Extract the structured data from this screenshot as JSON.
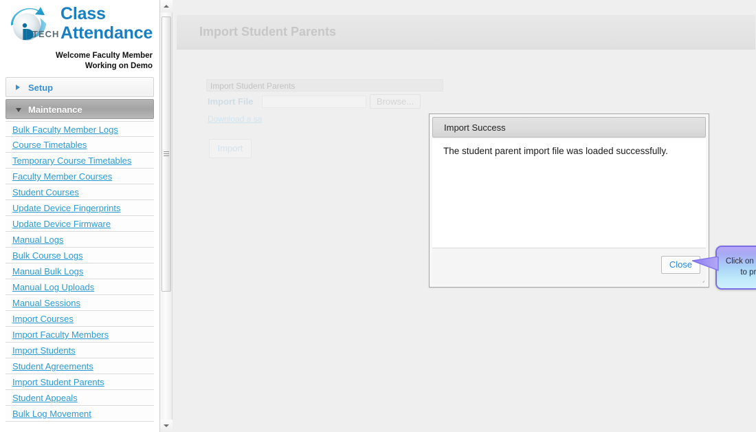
{
  "brand": {
    "logo_icon": "ip-tech-globe-logo",
    "logo_wordmark": "TECH",
    "title_line1": "Class",
    "title_line2": "Attendance",
    "welcome_line1": "Welcome Faculty Member",
    "welcome_line2": "Working on Demo"
  },
  "sidebar": {
    "sections": [
      {
        "label": "Setup",
        "expanded": false,
        "icon": "chevron-right-icon"
      },
      {
        "label": "Maintenance",
        "expanded": true,
        "icon": "chevron-down-icon"
      }
    ],
    "items": [
      {
        "label": "Bulk Faculty Member Logs"
      },
      {
        "label": "Course Timetables"
      },
      {
        "label": "Temporary Course Timetables"
      },
      {
        "label": "Faculty Member Courses"
      },
      {
        "label": "Student Courses"
      },
      {
        "label": "Update Device Fingerprints"
      },
      {
        "label": "Update Device Firmware"
      },
      {
        "label": "Manual Logs"
      },
      {
        "label": "Bulk Course Logs"
      },
      {
        "label": "Manual Bulk Logs"
      },
      {
        "label": "Manual Log Uploads"
      },
      {
        "label": "Manual Sessions"
      },
      {
        "label": "Import Courses"
      },
      {
        "label": "Import Faculty Members"
      },
      {
        "label": "Import Students"
      },
      {
        "label": "Student Agreements"
      },
      {
        "label": "Import Student Parents"
      },
      {
        "label": "Student Appeals"
      },
      {
        "label": "Bulk Log Movement"
      }
    ],
    "scrollbar": {
      "up_icon": "scroll-up-arrow-icon",
      "down_icon": "scroll-down-arrow-icon",
      "grip_icon": "scrollbar-grip-icon"
    }
  },
  "page": {
    "header_title": "Import Student Parents"
  },
  "form": {
    "panel_title": "Import Student Parents",
    "import_file_label": "Import File",
    "import_file_value": "",
    "browse_label": "Browse...",
    "sample_link_label": "Download a sa",
    "import_button_label": "Import"
  },
  "dialog": {
    "title": "Import Success",
    "message": "The student parent import file was loaded successfully.",
    "close_label": "Close",
    "resize_icon": "resize-grip-icon"
  },
  "callout": {
    "line1": "Click on this button",
    "line2": "to proceed",
    "pointer_icon": "callout-pointer-icon"
  },
  "colors": {
    "brand_blue": "#1a7fc1",
    "link_blue": "#2b9ad4",
    "callout_border": "#7a6de8",
    "callout_top": "#b9a8f5",
    "callout_bottom": "#cdf0fc"
  }
}
